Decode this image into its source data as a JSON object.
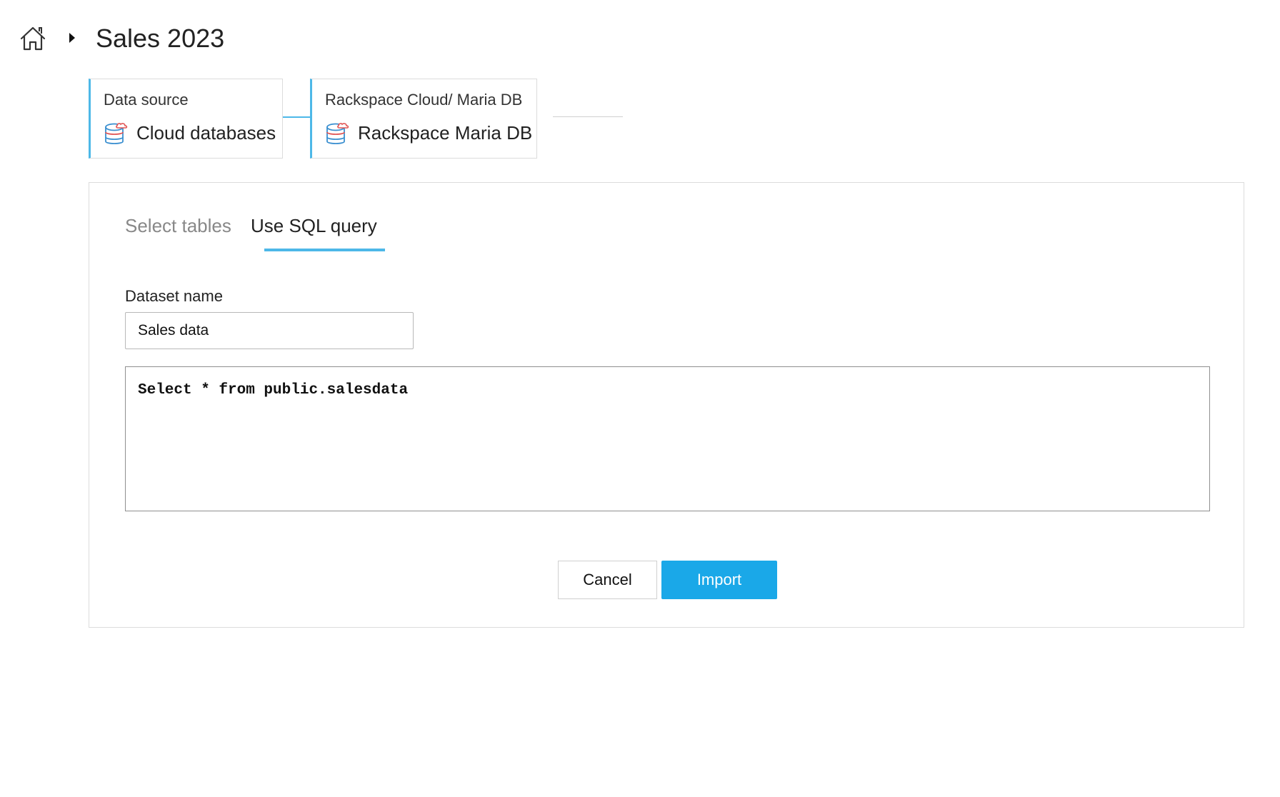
{
  "header": {
    "title": "Sales 2023",
    "home_icon": "home-icon",
    "separator_icon": "caret-right-icon"
  },
  "steps": [
    {
      "label": "Data source",
      "value": "Cloud databases",
      "icon": "cloud-database-icon"
    },
    {
      "label": "Rackspace Cloud/ Maria DB",
      "value": "Rackspace Maria DB",
      "icon": "cloud-database-icon"
    }
  ],
  "tabs": {
    "select_tables": "Select tables",
    "use_sql_query": "Use SQL query",
    "active": "use_sql_query"
  },
  "form": {
    "dataset_label": "Dataset name",
    "dataset_value": "Sales data",
    "sql_query": "Select * from public.salesdata"
  },
  "buttons": {
    "cancel": "Cancel",
    "import": "Import"
  },
  "colors": {
    "accent": "#4db8e8",
    "primary_button": "#1aa8e8",
    "icon_red": "#e05555",
    "icon_blue": "#3a8fd0"
  }
}
